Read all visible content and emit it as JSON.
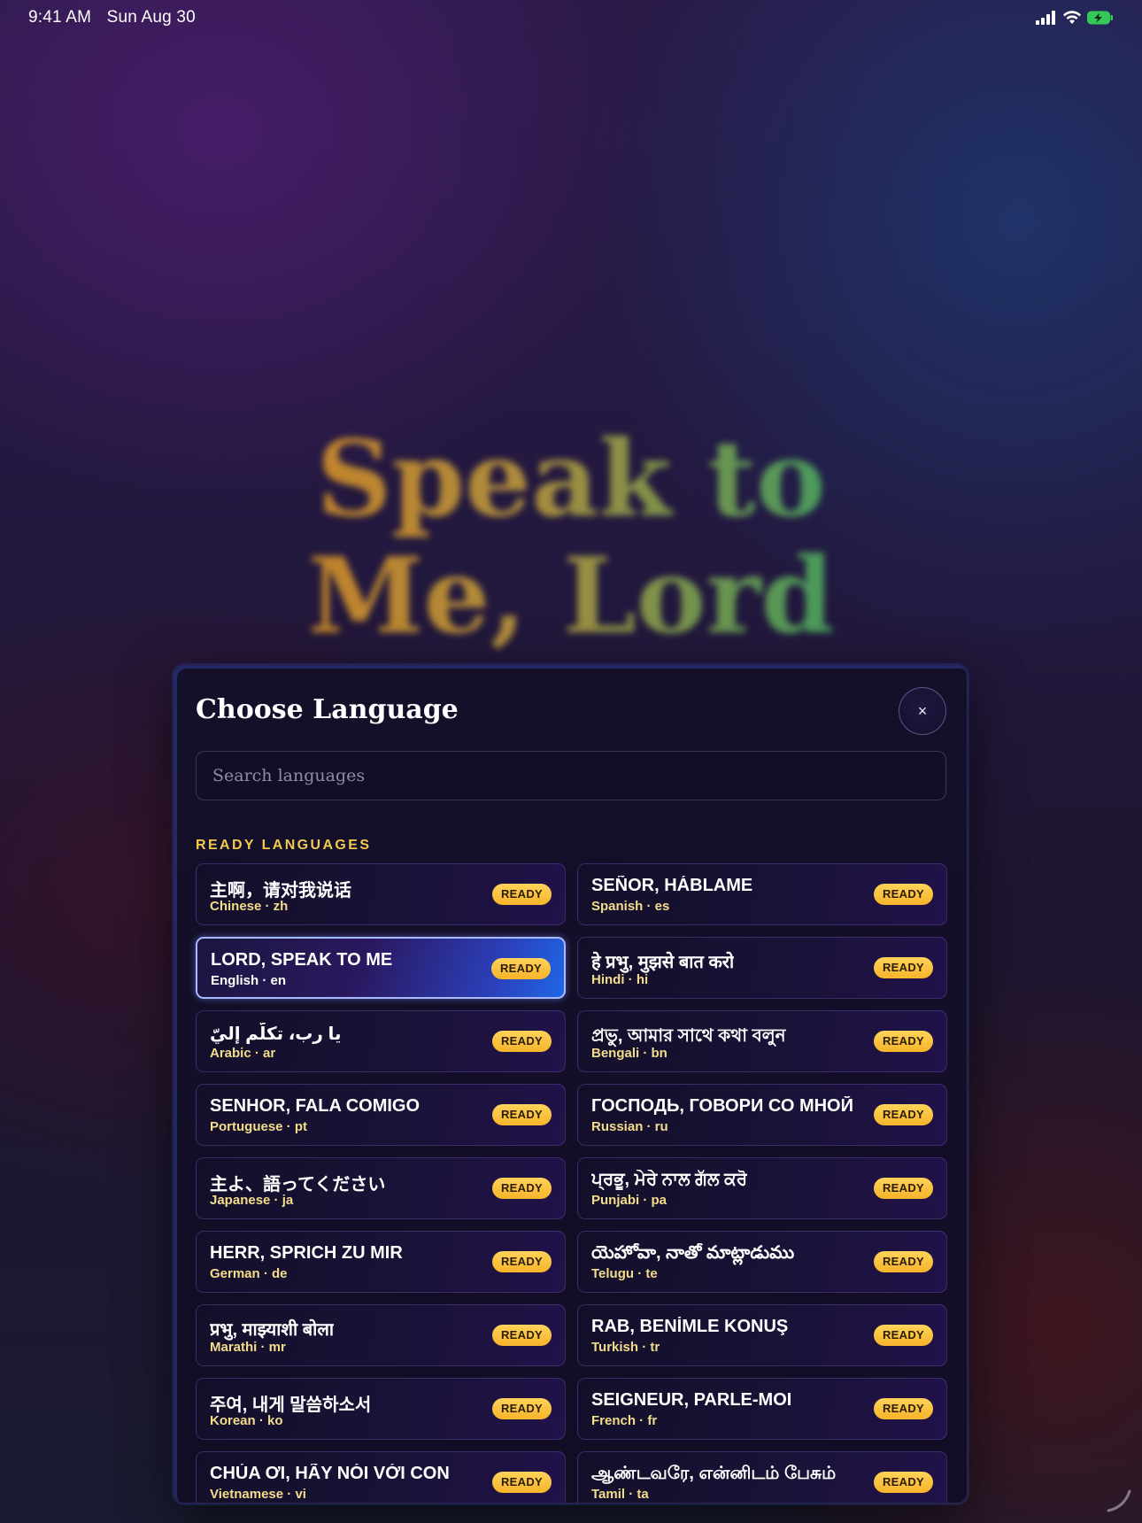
{
  "status_bar": {
    "time": "9:41 AM",
    "date": "Sun Aug 30"
  },
  "hero": {
    "line1": "Speak to",
    "line2": "Me, Lord"
  },
  "modal": {
    "title": "Choose Language",
    "close_label": "×",
    "search_placeholder": "Search languages",
    "section_label": "READY LANGUAGES",
    "badge_label": "READY",
    "languages": [
      {
        "phrase": "主啊，请对我说话",
        "meta": "Chinese · zh"
      },
      {
        "phrase": "SEÑOR, HÁBLAME",
        "meta": "Spanish · es"
      },
      {
        "phrase": "LORD, SPEAK TO ME",
        "meta": "English · en"
      },
      {
        "phrase": "हे प्रभु, मुझसे बात करो",
        "meta": "Hindi · hi"
      },
      {
        "phrase": "يا رب، تكلّم إليّ",
        "meta": "Arabic · ar"
      },
      {
        "phrase": "প্রভু, আমার সাথে কথা বলুন",
        "meta": "Bengali · bn"
      },
      {
        "phrase": "SENHOR, FALA COMIGO",
        "meta": "Portuguese · pt"
      },
      {
        "phrase": "ГОСПОДЬ, ГОВОРИ СО МНОЙ",
        "meta": "Russian · ru"
      },
      {
        "phrase": "主よ、語ってください",
        "meta": "Japanese · ja"
      },
      {
        "phrase": "ਪ੍ਰਭੂ, ਮੇਰੇ ਨਾਲ ਗੱਲ ਕਰੋ",
        "meta": "Punjabi · pa"
      },
      {
        "phrase": "HERR, SPRICH ZU MIR",
        "meta": "German · de"
      },
      {
        "phrase": "యెహోవా, నాతో మాట్లాడుము",
        "meta": "Telugu · te"
      },
      {
        "phrase": "प्रभु, माझ्याशी बोला",
        "meta": "Marathi · mr"
      },
      {
        "phrase": "RAB, BENİMLE KONUŞ",
        "meta": "Turkish · tr"
      },
      {
        "phrase": "주여, 내게 말씀하소서",
        "meta": "Korean · ko"
      },
      {
        "phrase": "SEIGNEUR, PARLE-MOI",
        "meta": "French · fr"
      },
      {
        "phrase": "CHÚA ƠI, HÃY NÓI VỚI CON",
        "meta": "Vietnamese · vi"
      },
      {
        "phrase": "ஆண்டவரே, என்னிடம் பேசும்",
        "meta": "Tamil · ta"
      }
    ]
  },
  "colors": {
    "accent_gold": "#f2c94c",
    "selected_blue": "#1f67e6",
    "battery_green": "#34c759"
  },
  "icons": [
    "signal-icon",
    "wifi-icon",
    "battery-charging-icon",
    "close-icon",
    "resize-grip-icon"
  ]
}
